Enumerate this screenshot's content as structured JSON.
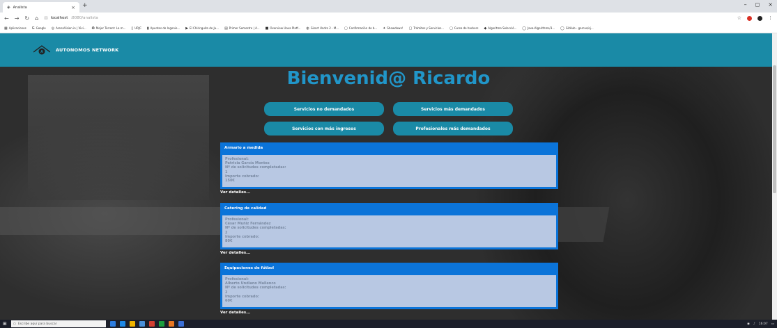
{
  "browser": {
    "tab_title": "Analista",
    "tab_close": "×",
    "new_tab": "+",
    "url_host": "localhost",
    "url_rest": ":8080/analista",
    "window_controls": [
      "–",
      "◻",
      "×"
    ]
  },
  "bookmarks": [
    {
      "label": "Aplicaciones",
      "icon": "apps-grid-icon"
    },
    {
      "label": "Google",
      "icon": "google-icon"
    },
    {
      "label": "ArenaVision.in | Vivi...",
      "icon": "arenavision-icon"
    },
    {
      "label": "Mejor Torrent: La m...",
      "icon": "torrent-icon"
    },
    {
      "label": "URJC",
      "icon": "urjc-icon"
    },
    {
      "label": "Apuntes de Ingenie...",
      "icon": "notes-icon"
    },
    {
      "label": "El Chiringuito de Ju...",
      "icon": "youtube-icon"
    },
    {
      "label": "Primer Semestre | A...",
      "icon": "calendar-icon"
    },
    {
      "label": "Overview Uava Platf...",
      "icon": "overview-icon"
    },
    {
      "label": "Gisart Undro 2 - M...",
      "icon": "gisart-icon"
    },
    {
      "label": "Confirmación de b...",
      "icon": "page-icon"
    },
    {
      "label": "Showdown!",
      "icon": "showdown-icon"
    },
    {
      "label": "Trámites y Servicios...",
      "icon": "page-icon"
    },
    {
      "label": "Curso de hackers",
      "icon": "page-icon"
    },
    {
      "label": "Algoritmo Selecció...",
      "icon": "algo-icon"
    },
    {
      "label": "Java-Algorithms/3...",
      "icon": "github-icon"
    },
    {
      "label": "GitHub - garcus/oj...",
      "icon": "github-icon"
    }
  ],
  "site": {
    "brand": "AUTONOMOS NETWORK",
    "welcome": "Bienvenid@ Ricardo",
    "buttons": [
      "Servicios no demandados",
      "Servicios más demandados",
      "Servicios con más ingresos",
      "Profesionales más demandados"
    ],
    "cards": [
      {
        "title": "Armario a medida",
        "prof_label": "Profesional:",
        "prof_name": "Patricia García Montes",
        "count_label": "Nº de solicitudes completadas:",
        "count": "1",
        "amount_label": "Importe cobrado:",
        "amount": "150€",
        "more": "Ver detalles..."
      },
      {
        "title": "Catering de calidad",
        "prof_label": "Profesional:",
        "prof_name": "César Muñiz Fernández",
        "count_label": "Nº de solicitudes completadas:",
        "count": "2",
        "amount_label": "Importe cobrado:",
        "amount": "80€",
        "more": "Ver detalles..."
      },
      {
        "title": "Equipaciones de fútbol",
        "prof_label": "Profesional:",
        "prof_name": "Alberto Undiano Mallenco",
        "count_label": "Nº de solicitudes completadas:",
        "count": "2",
        "amount_label": "Importe cobrado:",
        "amount": "60€",
        "more": "Ver detalles..."
      }
    ]
  },
  "taskbar": {
    "search_placeholder": "Escribe aquí para buscar",
    "time": "16:07"
  },
  "colors": {
    "navbar": "#1a8aa6",
    "welcome": "#2196c9",
    "card_header": "#0b74d9",
    "card_body": "#b8c8e3"
  }
}
